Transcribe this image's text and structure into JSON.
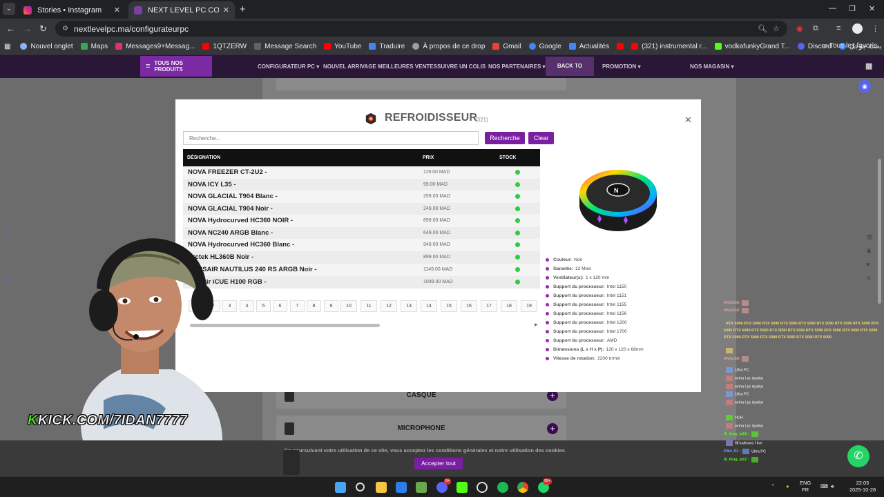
{
  "browser": {
    "tabs": [
      {
        "title": "Stories • Instagram",
        "active": false
      },
      {
        "title": "NEXT LEVEL PC CONFIGURATEUR",
        "active": true
      }
    ],
    "url": "nextlevelpc.ma/configurateurpc",
    "bookmarks": [
      {
        "label": "Nouvel onglet",
        "color": "#8ab4f8"
      },
      {
        "label": "Maps",
        "color": "#34a853"
      },
      {
        "label": "Messages9+Messag...",
        "color": "#e1306c"
      },
      {
        "label": "1QTZERW",
        "color": "#ff0000"
      },
      {
        "label": "Message Search",
        "color": "#5f6368"
      },
      {
        "label": "YouTube",
        "color": "#ff0000"
      },
      {
        "label": "Traduire",
        "color": "#4285f4"
      },
      {
        "label": "À propos de ce drop",
        "color": "#9aa0a6"
      },
      {
        "label": "Gmail",
        "color": "#ea4335"
      },
      {
        "label": "Google",
        "color": "#4285f4"
      },
      {
        "label": "Actualités",
        "color": "#4285f4"
      },
      {
        "label": "",
        "color": "#ff0000"
      },
      {
        "label": "(321) instrumental r...",
        "color": "#ff0000"
      },
      {
        "label": "vodkafunkyGrand T...",
        "color": "#53fc18"
      },
      {
        "label": "Discord",
        "color": "#5865f2"
      },
      {
        "label": "الفيسبوك - بحث جوجل",
        "color": "#4285f4"
      }
    ],
    "all_bookmarks": "Tous les favoris"
  },
  "site_nav": {
    "all_products": "TOUS NOS PRODUITS",
    "items": [
      "CONFIGURATEUR PC",
      "NOUVEL ARRIVAGE",
      "MEILLEURES VENTES",
      "SUIVRE UN COLIS",
      "NOS PARTENAIRES",
      "BACK TO SCHOOL",
      "PROMOTION",
      "NOS MAGASIN"
    ]
  },
  "background_cards": [
    "CASQUE",
    "MICROPHONE"
  ],
  "modal": {
    "title": "REFROIDISSEUR",
    "count": "(321)",
    "search_placeholder": "Recherche...",
    "search_button": "Recherche",
    "clear_button": "Clear",
    "columns": [
      "DÉSIGNATION",
      "PRIX",
      "STOCK"
    ],
    "rows": [
      {
        "name": "NOVA FREEZER CT-2U2 -",
        "price": "119.00 MAD",
        "in_stock": true
      },
      {
        "name": "NOVA ICY L35 -",
        "price": "99.00 MAD",
        "in_stock": true
      },
      {
        "name": "NOVA GLACIAL T904 Blanc -",
        "price": "259.00 MAD",
        "in_stock": true
      },
      {
        "name": "NOVA GLACIAL T904 Noir -",
        "price": "249.00 MAD",
        "in_stock": true
      },
      {
        "name": "NOVA Hydrocurved HC360 NOIR -",
        "price": "899.00 MAD",
        "in_stock": true
      },
      {
        "name": "NOVA NC240 ARGB Blanc -",
        "price": "649.00 MAD",
        "in_stock": true
      },
      {
        "name": "NOVA Hydrocurved HC360 Blanc -",
        "price": "949.00 MAD",
        "in_stock": true
      },
      {
        "name": "Arctek HL360B Noir -",
        "price": "899.00 MAD",
        "in_stock": true
      },
      {
        "name": "CORSAIR NAUTILUS 240 RS ARGB Noir -",
        "price": "1149.00 MAD",
        "in_stock": true
      },
      {
        "name": "Corsair iCUE H100 RGB -",
        "price": "1099.00 MAD",
        "in_stock": true
      }
    ],
    "pages": [
      "1",
      "2",
      "3",
      "4",
      "5",
      "6",
      "7",
      "8",
      "9",
      "10",
      "11",
      "12",
      "13",
      "14",
      "15",
      "16",
      "17",
      "18",
      "19"
    ],
    "specs": [
      {
        "key": "Couleur:",
        "value": "Noir"
      },
      {
        "key": "Garantie:",
        "value": "12 Mois"
      },
      {
        "key": "Ventilateur(s):",
        "value": "1 x 120 mm"
      },
      {
        "key": "Support du processeur:",
        "value": "Intel 1150"
      },
      {
        "key": "Support du processeur:",
        "value": "Intel 1151"
      },
      {
        "key": "Support du processeur:",
        "value": "Intel 1155"
      },
      {
        "key": "Support du processeur:",
        "value": "Intel 1156"
      },
      {
        "key": "Support du processeur:",
        "value": "Intel 1200"
      },
      {
        "key": "Support du processeur:",
        "value": "Intel 1700"
      },
      {
        "key": "Support du processeur:",
        "value": "AMD"
      },
      {
        "key": "Dimensions (L x H x P):",
        "value": "120 x 120 x 68mm"
      },
      {
        "key": "Vitesse de rotation:",
        "value": "2200 tr/min"
      }
    ]
  },
  "cookie": {
    "text": "En poursuivant votre utilisation de ce site, vous acceptez les conditions générales et notre utilisation des cookies.",
    "accept": "Accepter tout"
  },
  "stream": {
    "kick_prefix": "K",
    "kick_text": "KICK.COM/7IDAN7777",
    "chat": [
      {
        "user": "ANAZSK",
        "text": "",
        "color": "#e6a0a0"
      },
      {
        "user": "ANAZSK",
        "text": "",
        "color": "#e6a0a0"
      },
      {
        "user": "",
        "text": "RTX 5090 RTX 5090 RTX 5090 RTX 5090 RTX 5090 RTX 5090 RTX 5090 RTX 5090 RTX 5090 RTX 5090 RTX 5090 RTX 5090 RTX 5090 RTX 5090 RTX 5090 RTX 5090 RTX 5090 RTX 5090 RTX 5090 RTX 5090 RTX 5090 RTX 5090 RTX 5090",
        "color": "#f5d76e"
      },
      {
        "user": "",
        "text": "",
        "color": "#f5d76e"
      },
      {
        "user": "ANAZSK",
        "text": "",
        "color": "#e6a0a0"
      },
      {
        "user": "",
        "text": "Ultra PC",
        "color": "#7fa7ff"
      },
      {
        "user": "",
        "text": "wrina l pc dyalna",
        "color": "#e67e7e"
      },
      {
        "user": "",
        "text": "wrina l pc dyalna",
        "color": "#e67e7e"
      },
      {
        "user": "",
        "text": "Ultra PC",
        "color": "#7fa7ff"
      },
      {
        "user": "",
        "text": "wrina l pc dyalna",
        "color": "#e67e7e"
      },
      {
        "user": "",
        "text": "HUH",
        "color": "#53fc18"
      },
      {
        "user": "",
        "text": "wrina l pc dyalna",
        "color": "#e67e7e"
      },
      {
        "user": "lil_thug_ja12 :",
        "text": "",
        "color": "#53fc18"
      },
      {
        "user": "",
        "text": "fifi kathows f live",
        "color": "#a0a0ff"
      },
      {
        "user": "D4vi_01 :",
        "text": "Ultra PC",
        "color": "#7fa7ff"
      },
      {
        "user": "lil_thug_ja12 :",
        "text": "",
        "color": "#53fc18"
      }
    ]
  },
  "taskbar": {
    "badges": [
      "9+",
      "99+"
    ],
    "lang": "ENG",
    "region": "FR",
    "time": "22:05",
    "date": "2025-10-28"
  },
  "colors": {
    "accent": "#7b1fa2",
    "nav_bg": "#2a1636",
    "stock_ok": "#2ecc40",
    "kick_green": "#53fc18"
  }
}
